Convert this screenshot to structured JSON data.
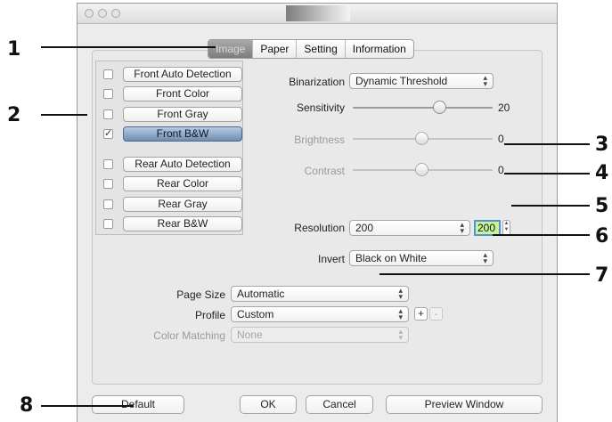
{
  "callouts": [
    "1",
    "2",
    "3",
    "4",
    "5",
    "6",
    "7",
    "8"
  ],
  "tabs": [
    "Image",
    "Paper",
    "Setting",
    "Information"
  ],
  "image_types": [
    {
      "label": "Front Auto Detection",
      "checked": false
    },
    {
      "label": "Front Color",
      "checked": false
    },
    {
      "label": "Front Gray",
      "checked": false
    },
    {
      "label": "Front B&W",
      "checked": true
    },
    {
      "label": "Rear Auto Detection",
      "checked": false
    },
    {
      "label": "Rear Color",
      "checked": false
    },
    {
      "label": "Rear Gray",
      "checked": false
    },
    {
      "label": "Rear B&W",
      "checked": false
    }
  ],
  "settings": {
    "binarization": {
      "label": "Binarization",
      "value": "Dynamic Threshold"
    },
    "sensitivity": {
      "label": "Sensitivity",
      "value": "20"
    },
    "brightness": {
      "label": "Brightness",
      "value": "0",
      "disabled": true
    },
    "contrast": {
      "label": "Contrast",
      "value": "0",
      "disabled": true
    },
    "resolution": {
      "label": "Resolution",
      "value": "200",
      "custom_value": "200"
    },
    "invert": {
      "label": "Invert",
      "value": "Black on White"
    }
  },
  "page_size": {
    "label": "Page Size",
    "value": "Automatic"
  },
  "profile": {
    "label": "Profile",
    "value": "Custom",
    "add": "+",
    "remove": "-"
  },
  "color_matching": {
    "label": "Color Matching",
    "value": "None",
    "disabled": true
  },
  "buttons": {
    "default": "Default",
    "ok": "OK",
    "cancel": "Cancel",
    "preview": "Preview Window"
  },
  "checkmark": "✓",
  "colors": {
    "selected_button": "#6f8db0",
    "resolution_field": "#c4f59a",
    "focus_ring": "#5b8fcf"
  }
}
